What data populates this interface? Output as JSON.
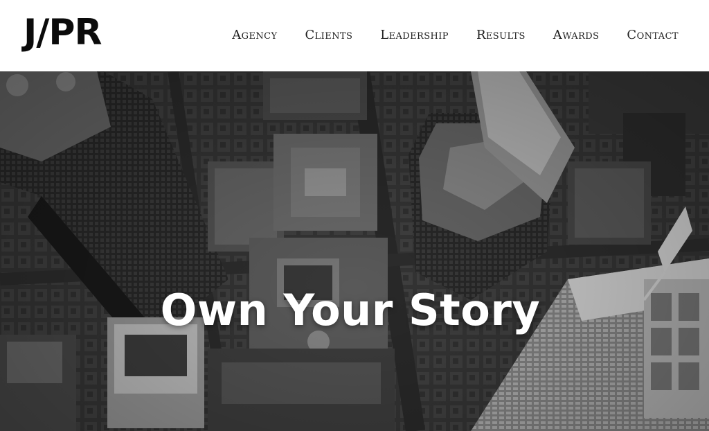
{
  "header": {
    "logo_text": "J/PR",
    "nav": [
      {
        "label": "Agency"
      },
      {
        "label": "Clients"
      },
      {
        "label": "Leadership"
      },
      {
        "label": "Results"
      },
      {
        "label": "Awards"
      },
      {
        "label": "Contact"
      }
    ]
  },
  "hero": {
    "title": "Own Your Story",
    "background_image": "aerial-city-skyline-grayscale"
  },
  "colors": {
    "header_bg": "#ffffff",
    "text_dark": "#1e1e1e",
    "hero_text": "#ffffff"
  }
}
